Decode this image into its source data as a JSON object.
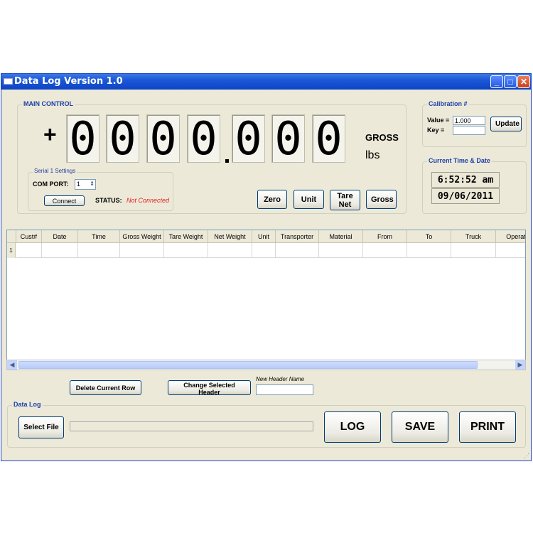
{
  "window": {
    "title": "Data Log Version 1.0",
    "controls": {
      "minimize": "_",
      "maximize": "□",
      "close": "✕"
    }
  },
  "main_control": {
    "group_title": "MAIN CONTROL",
    "sign": "+",
    "digits": [
      "0",
      "0",
      "0",
      "0",
      "0",
      "0",
      "0"
    ],
    "mode": "GROSS",
    "unit": "lbs",
    "buttons": {
      "zero": "Zero",
      "unit": "Unit",
      "tare_net": "Tare Net",
      "gross": "Gross"
    }
  },
  "serial": {
    "group_title": "Serial 1 Settings",
    "com_port_label": "COM PORT:",
    "com_port_value": "1",
    "connect_button": "Connect",
    "status_label": "STATUS:",
    "status_value": "Not Connected",
    "status_color": "#e02020"
  },
  "calibration": {
    "group_title": "Calibration #",
    "value_label": "Value =",
    "value": "1.000",
    "key_label": "Key =",
    "key_value": "",
    "update_button": "Update"
  },
  "clock": {
    "group_title": "Current Time & Date",
    "time": "6:52:52 am",
    "date": "09/06/2011"
  },
  "grid": {
    "columns": [
      "Cust#",
      "Date",
      "Time",
      "Gross Weight",
      "Tare Weight",
      "Net Weight",
      "Unit",
      "Transporter",
      "Material",
      "From",
      "To",
      "Truck",
      "Operato"
    ],
    "rows": [
      {
        "index": "1",
        "cells": [
          "",
          "",
          "",
          "",
          "",
          "",
          "",
          "",
          "",
          "",
          "",
          "",
          ""
        ]
      }
    ]
  },
  "actions": {
    "delete_row": "Delete Current Row",
    "change_header": "Change Selected Header",
    "new_header_label": "New Header Name",
    "new_header_value": ""
  },
  "data_log": {
    "group_title": "Data Log",
    "select_file": "Select File",
    "file_path": "",
    "log": "LOG",
    "save": "SAVE",
    "print": "PRINT"
  }
}
